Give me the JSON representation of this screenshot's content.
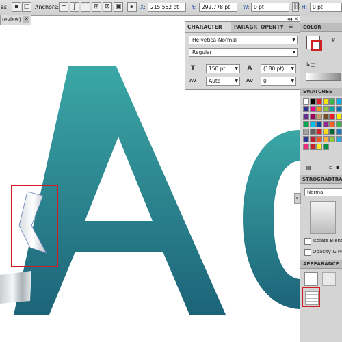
{
  "control_bar": {
    "partial_label": "as:",
    "anchors_label": "Anchors:",
    "x_label": "X:",
    "x_value": "215.562 pt",
    "y_label": "Y:",
    "y_value": "292.778 pt",
    "w_label": "W:",
    "w_value": "0 pt",
    "h_label": "H:",
    "h_value": "0 pt"
  },
  "document_tab": {
    "label": "review)",
    "close": "✕"
  },
  "character_panel": {
    "tabs": [
      "CHARACTER",
      "PARAGR",
      "OPENTY"
    ],
    "font_family": "Helvetica-Normal",
    "font_style": "Regular",
    "font_size": "150 pt",
    "leading": "(180 pt)",
    "kerning": "Auto",
    "tracking": "0",
    "collapse": "◂◂",
    "close": "✕"
  },
  "color_panel": {
    "tab": "COLOR",
    "k_label": "K"
  },
  "swatches_panel": {
    "tab": "SWATCHES"
  },
  "gradient_panel": {
    "tabs": [
      "STRO",
      "GRAD",
      "TRAN"
    ],
    "blend_mode": "Normal",
    "isolate_label": "Isolate Blend",
    "opacity_label": "Opacity & M"
  },
  "appearance_panel": {
    "tab": "APPEARANCE"
  },
  "colors": {
    "teal_top": "#3ba7a6",
    "teal_bottom": "#1d6479",
    "highlight_red": "#d21c25"
  }
}
